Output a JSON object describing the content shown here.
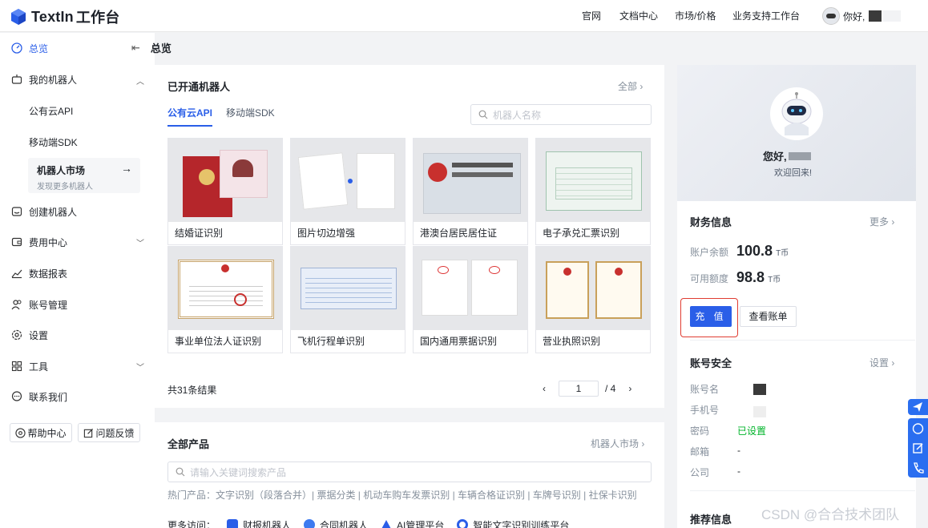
{
  "header": {
    "brand": "TextIn",
    "brand_suffix": "工作台",
    "nav": [
      "官网",
      "文档中心",
      "市场/价格",
      "业务支持工作台"
    ],
    "greeting": "你好,"
  },
  "sidebar": {
    "overview": "总览",
    "my_robots": "我的机器人",
    "public_api": "公有云API",
    "mobile_sdk": "移动端SDK",
    "market_title": "机器人市场",
    "market_sub": "发现更多机器人",
    "create_robot": "创建机器人",
    "billing": "费用中心",
    "reports": "数据报表",
    "account": "账号管理",
    "settings": "设置",
    "tools": "工具",
    "contact": "联系我们",
    "help": "帮助中心",
    "feedback": "问题反馈"
  },
  "breadcrumb": {
    "title": "总览"
  },
  "opened": {
    "title": "已开通机器人",
    "all_link": "全部",
    "tabs": [
      "公有云API",
      "移动端SDK"
    ],
    "search_placeholder": "机器人名称",
    "cards": [
      "结婚证识别",
      "图片切边增强",
      "港澳台居民居住证",
      "电子承兑汇票识别",
      "事业单位法人证识别",
      "飞机行程单识别",
      "国内通用票据识别",
      "营业执照识别"
    ],
    "total": "共31条结果",
    "page": "1",
    "pages": "/ 4"
  },
  "products": {
    "title": "全部产品",
    "link": "机器人市场",
    "search_placeholder": "请输入关键词搜索产品",
    "hot": "热门产品：文字识别（段落合并）| 票据分类 | 机动车购车发票识别 | 车辆合格证识别 | 车牌号识别 | 社保卡识别",
    "more_label": "更多访问：",
    "more": [
      "财报机器人",
      "合同机器人",
      "AI管理平台",
      "智能文字识别训练平台"
    ]
  },
  "profile": {
    "greeting": "您好,",
    "welcome": "欢迎回来!"
  },
  "finance": {
    "title": "财务信息",
    "more": "更多",
    "balance_label": "账户余额",
    "balance": "100.8",
    "quota_label": "可用额度",
    "quota": "98.8",
    "unit": "T币",
    "recharge": "充 值",
    "bills": "查看账单"
  },
  "security": {
    "title": "账号安全",
    "settings": "设置",
    "name_label": "账号名",
    "phone_label": "手机号",
    "password_label": "密码",
    "password_status": "已设置",
    "email_label": "邮箱",
    "email_val": "-",
    "company_label": "公司",
    "company_val": "-"
  },
  "recommend": {
    "title": "推荐信息"
  },
  "watermark": "CSDN @合合技术团队",
  "colors": {
    "accent": "#2a5ee8",
    "success": "#00b42a",
    "highlight": "#e03c31"
  }
}
